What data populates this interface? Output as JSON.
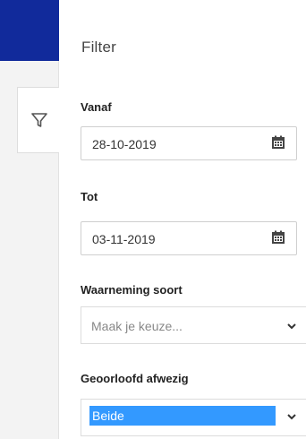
{
  "colors": {
    "brand": "#112a9b",
    "rail": "#f3f3f3",
    "selection": "#3399ff"
  },
  "sidebar": {
    "filter_tab_icon": "funnel-icon"
  },
  "panel": {
    "title": "Filter",
    "from": {
      "label": "Vanaf",
      "value": "28-10-2019",
      "icon": "calendar-icon"
    },
    "to": {
      "label": "Tot",
      "value": "03-11-2019",
      "icon": "calendar-icon"
    },
    "observation_type": {
      "label": "Waarneming soort",
      "placeholder": "Maak je keuze...",
      "icon": "chevron-down-icon"
    },
    "authorized_absent": {
      "label": "Geoorloofd afwezig",
      "value": "Beide",
      "icon": "chevron-down-icon"
    }
  }
}
